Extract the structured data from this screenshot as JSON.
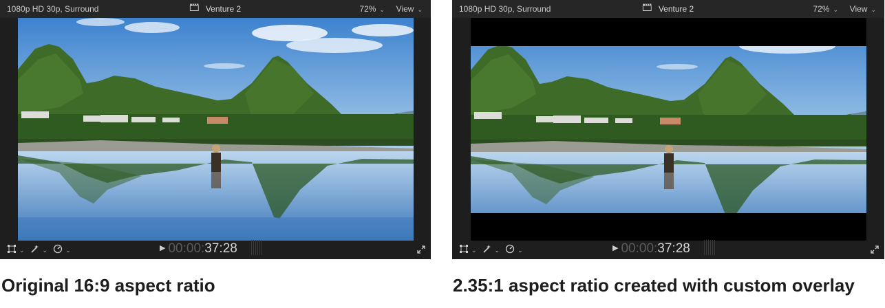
{
  "viewers": [
    {
      "format": "1080p HD 30p, Surround",
      "project_title": "Venture 2",
      "zoom": "72%",
      "view_menu": "View",
      "timecode_dim": "00:00:",
      "timecode_main": "37:28",
      "overlay": "none"
    },
    {
      "format": "1080p HD 30p, Surround",
      "project_title": "Venture 2",
      "zoom": "72%",
      "view_menu": "View",
      "timecode_dim": "00:00:",
      "timecode_main": "37:28",
      "overlay": "2.35:1 letterbox"
    }
  ],
  "captions": {
    "left": "Original 16:9 aspect ratio",
    "right": "2.35:1 aspect ratio created with custom overlay"
  },
  "icons": {
    "clapper": "clapperboard-icon",
    "transform": "transform-icon",
    "enhance": "magic-wand-icon",
    "retime": "speedometer-icon",
    "play": "play-icon",
    "fullscreen": "fullscreen-icon"
  },
  "colors": {
    "viewer_background": "#1e1e1e",
    "toolbar_background": "#262626",
    "caption_text": "#1d1d1f",
    "sky": "#4a8ed4",
    "mountain": "#3f6b28"
  }
}
